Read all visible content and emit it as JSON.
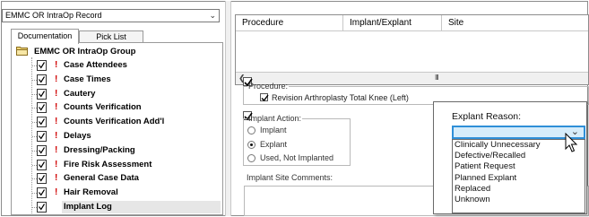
{
  "record_select": {
    "value": "EMMC OR IntraOp Record"
  },
  "tabs": [
    {
      "label": "Documentation",
      "active": true
    },
    {
      "label": "Pick List",
      "active": false
    }
  ],
  "tree": {
    "root_label": "EMMC OR IntraOp Group",
    "items": [
      {
        "label": "Case Attendees",
        "required": true
      },
      {
        "label": "Case Times",
        "required": true
      },
      {
        "label": "Cautery",
        "required": true
      },
      {
        "label": "Counts Verification",
        "required": true
      },
      {
        "label": "Counts Verification Add'l",
        "required": true
      },
      {
        "label": "Delays",
        "required": true
      },
      {
        "label": "Dressing/Packing",
        "required": true
      },
      {
        "label": "Fire Risk Assessment",
        "required": true
      },
      {
        "label": "General Case Data",
        "required": true
      },
      {
        "label": "Hair Removal",
        "required": true
      },
      {
        "label": "Implant Log",
        "required": false,
        "selected": true
      }
    ]
  },
  "grid": {
    "columns": [
      "Procedure",
      "Implant/Explant",
      "Site"
    ],
    "scroll_grip": "III"
  },
  "procedure": {
    "legend": "Procedure:",
    "value": "Revision Arthroplasty Total Knee (Left)"
  },
  "implant_action": {
    "legend": "Implant Action:",
    "options": [
      {
        "label": "Implant",
        "selected": false
      },
      {
        "label": "Explant",
        "selected": true
      },
      {
        "label": "Used, Not Implanted",
        "selected": false
      }
    ]
  },
  "implant_site_comments": {
    "label": "Implant Site Comments:"
  },
  "explant_reason": {
    "label": "Explant Reason:",
    "selected_value": "",
    "options": [
      "Clinically Unnecessary",
      "Defective/Recalled",
      "Patient Request",
      "Planned Explant",
      "Replaced",
      "Unknown"
    ]
  },
  "colors": {
    "required_marker": "#d00000",
    "dropdown_focus": "#2f8fd8",
    "dropdown_fill": "#d6ecfa",
    "selected_row": "#e6e6e6"
  }
}
